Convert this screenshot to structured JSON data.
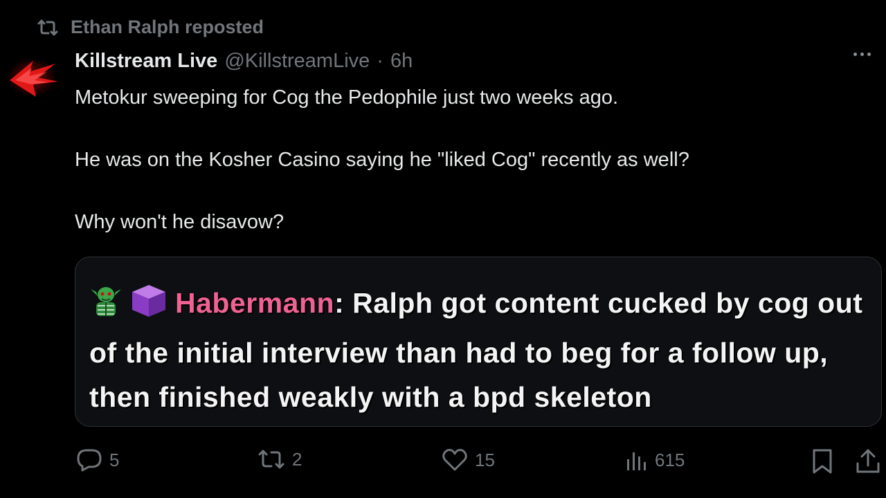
{
  "repost": {
    "text": "Ethan Ralph reposted",
    "icon": "repost-icon"
  },
  "tweet": {
    "display_name": "Killstream Live",
    "handle": "@KillstreamLive",
    "separator": "·",
    "time": "6h",
    "paragraphs": [
      "Metokur sweeping for Cog the Pedophile just two weeks ago.",
      "He was on the Kosher Casino saying he \"liked Cog\" recently as well?",
      "Why won't he disavow?"
    ]
  },
  "quote": {
    "author": "Habermann",
    "colon": ":",
    "message": " Ralph got content cucked by cog out of the initial interview than had to beg for a follow up, then finished weakly with a bpd skeleton",
    "author_color": "#f06292",
    "badges": [
      "goblin-emote-icon",
      "purple-cube-icon"
    ]
  },
  "actions": {
    "replies": "5",
    "reposts": "2",
    "likes": "15",
    "views": "615"
  },
  "colors": {
    "background": "#000000",
    "text": "#e7e9ea",
    "muted": "#71767b",
    "border": "#2f3336",
    "avatar_accent": "#e01818"
  }
}
